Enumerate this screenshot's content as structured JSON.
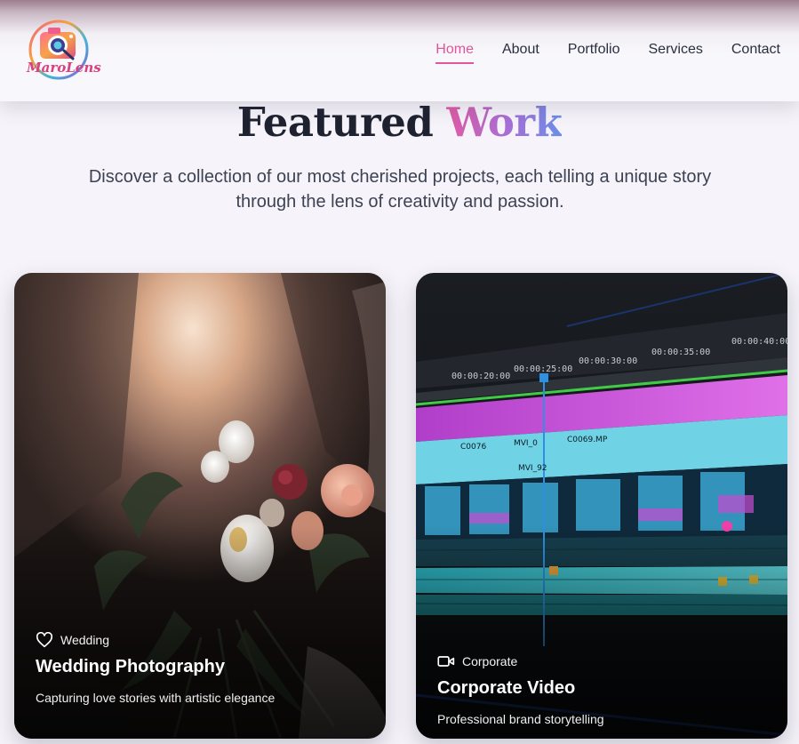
{
  "brand": {
    "name": "MaroLens"
  },
  "nav": {
    "items": [
      {
        "label": "Home",
        "active": true
      },
      {
        "label": "About"
      },
      {
        "label": "Portfolio"
      },
      {
        "label": "Services"
      },
      {
        "label": "Contact"
      }
    ]
  },
  "section": {
    "title_main": "Featured",
    "title_accent": "Work",
    "subtitle": "Discover a collection of our most cherished projects, each telling a unique story through the lens of creativity and passion."
  },
  "cards": [
    {
      "tag": "Wedding",
      "icon": "heart-icon",
      "title": "Wedding Photography",
      "description": "Capturing love stories with artistic elegance"
    },
    {
      "tag": "Corporate",
      "icon": "video-camera-icon",
      "title": "Corporate Video",
      "description": "Professional brand storytelling",
      "timeline": {
        "timecodes": [
          "00:00:20:00",
          "00:00:25:00",
          "00:00:30:00",
          "00:00:35:00",
          "00:00:40:00"
        ],
        "clips": [
          "C0076",
          "MVI_0",
          "C0069.MP",
          "MVI_92"
        ]
      }
    }
  ],
  "colors": {
    "accent_pink": "#e0569c",
    "accent_purple": "#a56fd8",
    "accent_blue": "#6a8ee8",
    "background": "#f6f4fa"
  }
}
